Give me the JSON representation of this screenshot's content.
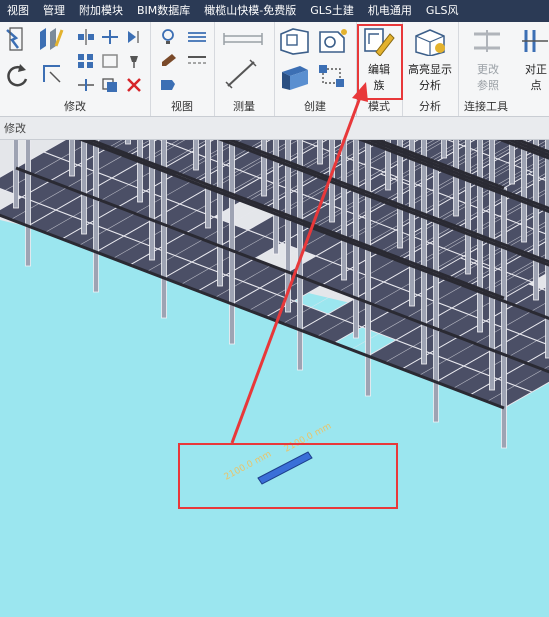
{
  "menu": [
    "视图",
    "管理",
    "附加模块",
    "BIM数据库",
    "橄榄山快模-免费版",
    "GLS土建",
    "机电通用",
    "GLS风"
  ],
  "ribbon": {
    "panels": {
      "modify": "修改",
      "view": "视图",
      "measure": "测量",
      "create": "创建",
      "mode": "模式",
      "analysis": "分析",
      "connect": "连接工具"
    },
    "buttons": {
      "edit_family": [
        "编辑",
        "族"
      ],
      "highlight_analysis": [
        "高亮显示",
        "分析"
      ],
      "change_reference": [
        "更改",
        "参照"
      ],
      "align_point": [
        "对正",
        "点"
      ]
    }
  },
  "properties_bar": {
    "title": "修改"
  },
  "viewport": {
    "dimension_1": "2100.0 mm",
    "dimension_2": "2100.0 mm"
  },
  "colors": {
    "menubar": "#2b3a55",
    "slab": "#4b4f66",
    "grid_lines": "#e8e8ee",
    "opening": "#5fe6f2",
    "highlight": "#e8383a",
    "selected_beam": "#3a6fd8"
  }
}
